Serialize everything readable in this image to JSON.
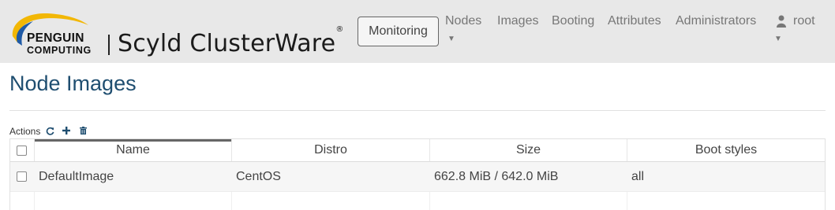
{
  "brand": {
    "penguin_line1": "PENGUIN",
    "penguin_line2": "COMPUTING",
    "product_name": "Scyld ClusterWare",
    "trademark": "®"
  },
  "header": {
    "monitoring_label": "Monitoring",
    "nav": [
      {
        "label": "Nodes",
        "has_dropdown": true
      },
      {
        "label": "Images",
        "has_dropdown": false
      },
      {
        "label": "Booting",
        "has_dropdown": false
      },
      {
        "label": "Attributes",
        "has_dropdown": false
      },
      {
        "label": "Administrators",
        "has_dropdown": false
      }
    ],
    "user": {
      "label": "root",
      "icon": "user-icon",
      "has_dropdown": true
    }
  },
  "main": {
    "title": "Node Images",
    "actions": {
      "label": "Actions",
      "icons": [
        "refresh-icon",
        "plus-icon",
        "trash-icon"
      ]
    },
    "table": {
      "columns": [
        "Name",
        "Distro",
        "Size",
        "Boot styles"
      ],
      "rows": [
        {
          "name": "DefaultImage",
          "distro": "CentOS",
          "size": "662.8 MiB / 642.0 MiB",
          "boot_styles": "all"
        }
      ]
    }
  },
  "colors": {
    "header_bg": "#e8e8e8",
    "title": "#1f4e70",
    "logo_accent_yellow": "#f2b705",
    "logo_accent_blue": "#1f5aa6"
  }
}
